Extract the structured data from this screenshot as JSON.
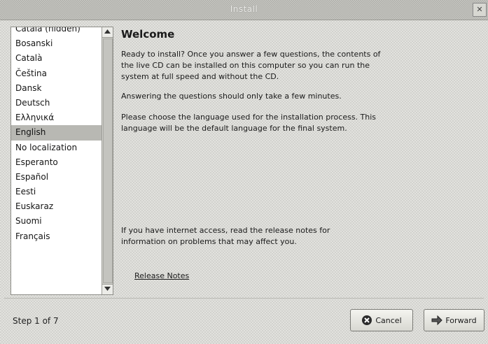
{
  "window": {
    "title": "Install",
    "close_glyph": "✕"
  },
  "languages": {
    "items": [
      "Català (hidden)",
      "Bosanski",
      "Català",
      "Čeština",
      "Dansk",
      "Deutsch",
      "Ελληνικά",
      "English",
      "No localization",
      "Esperanto",
      "Español",
      "Eesti",
      "Euskaraz",
      "Suomi",
      "Français"
    ],
    "selected": "English"
  },
  "main": {
    "heading": "Welcome",
    "intro": "Ready to install? Once you answer a few questions, the contents of the live CD can be installed on this computer so you can run the system at full speed and without the CD.",
    "time_note": "Answering the questions should only take a few minutes.",
    "choose_language": "Please choose the language used for the installation process. This language will be the default language for the final system.",
    "release_info": "If you have internet access, read the release notes for information on problems that may affect you.",
    "release_link": "Release Notes"
  },
  "footer": {
    "step": "Step 1 of 7",
    "cancel_label": "Cancel",
    "forward_label": "Forward"
  },
  "icons": {
    "cancel": "cancel-icon",
    "forward": "forward-icon",
    "scroll_up": "scroll-up-arrow-icon",
    "scroll_down": "scroll-down-arrow-icon"
  }
}
